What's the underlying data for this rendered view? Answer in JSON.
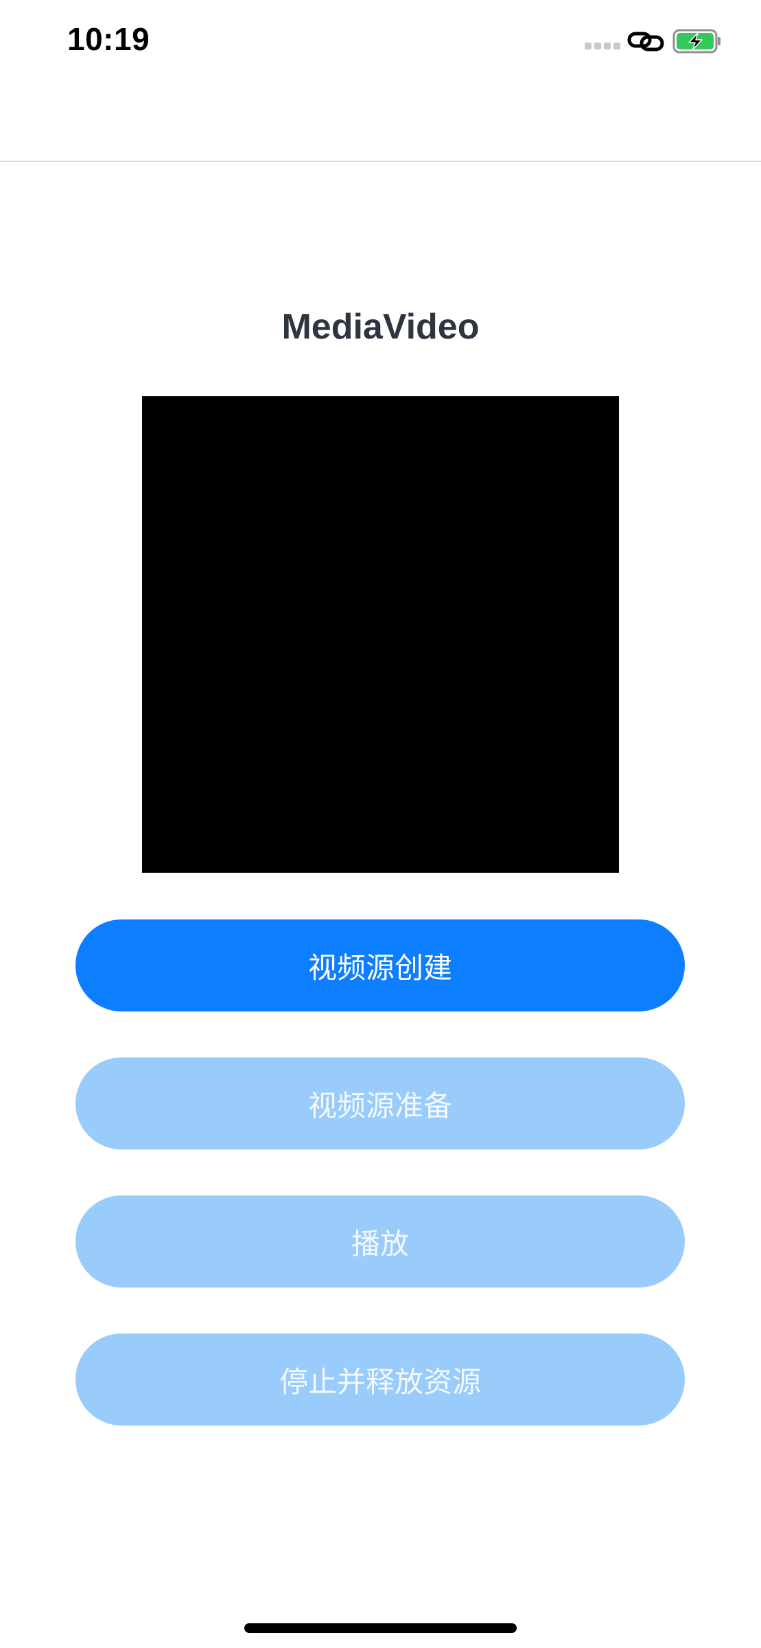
{
  "status_bar": {
    "time": "10:19",
    "icons": [
      "signal-dots-icon",
      "link-icon",
      "battery-charging-icon"
    ],
    "battery_color": "#34c759"
  },
  "page": {
    "title": "MediaVideo"
  },
  "video": {
    "background": "#000000"
  },
  "buttons": [
    {
      "label": "视频源创建",
      "state": "enabled",
      "color": "#0d7eff"
    },
    {
      "label": "视频源准备",
      "state": "disabled",
      "color": "#99cbfb"
    },
    {
      "label": "播放",
      "state": "disabled",
      "color": "#99cbfb"
    },
    {
      "label": "停止并释放资源",
      "state": "disabled",
      "color": "#99cbfb"
    }
  ]
}
